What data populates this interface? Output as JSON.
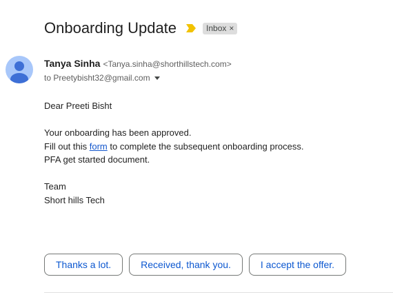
{
  "email": {
    "subject": "Onboarding Update",
    "importance_icon": "importance-marker-icon",
    "label": {
      "text": "Inbox",
      "close_glyph": "×"
    },
    "sender": {
      "name": "Tanya Sinha",
      "email": "<Tanya.sinha@shorthillstech.com>",
      "avatar_icon": "person-avatar-icon"
    },
    "recipient": "to Preetybisht32@gmail.com",
    "body": {
      "greeting": "Dear Preeti Bisht",
      "line1": "Your onboarding has been approved.",
      "line2_before": "Fill out this ",
      "line2_link": "form",
      "line2_after": " to complete the subsequent onboarding process.",
      "line3": "PFA get started document.",
      "signoff1": "Team",
      "signoff2": "Short hills Tech"
    },
    "smart_replies": [
      "Thanks a lot.",
      "Received, thank you.",
      "I accept the offer."
    ]
  },
  "colors": {
    "link": "#1155cc",
    "reply_text": "#0b57d0",
    "importance": "#f2c200",
    "avatar_bg": "#a8c7fa",
    "avatar_fg": "#3d6fd6"
  }
}
